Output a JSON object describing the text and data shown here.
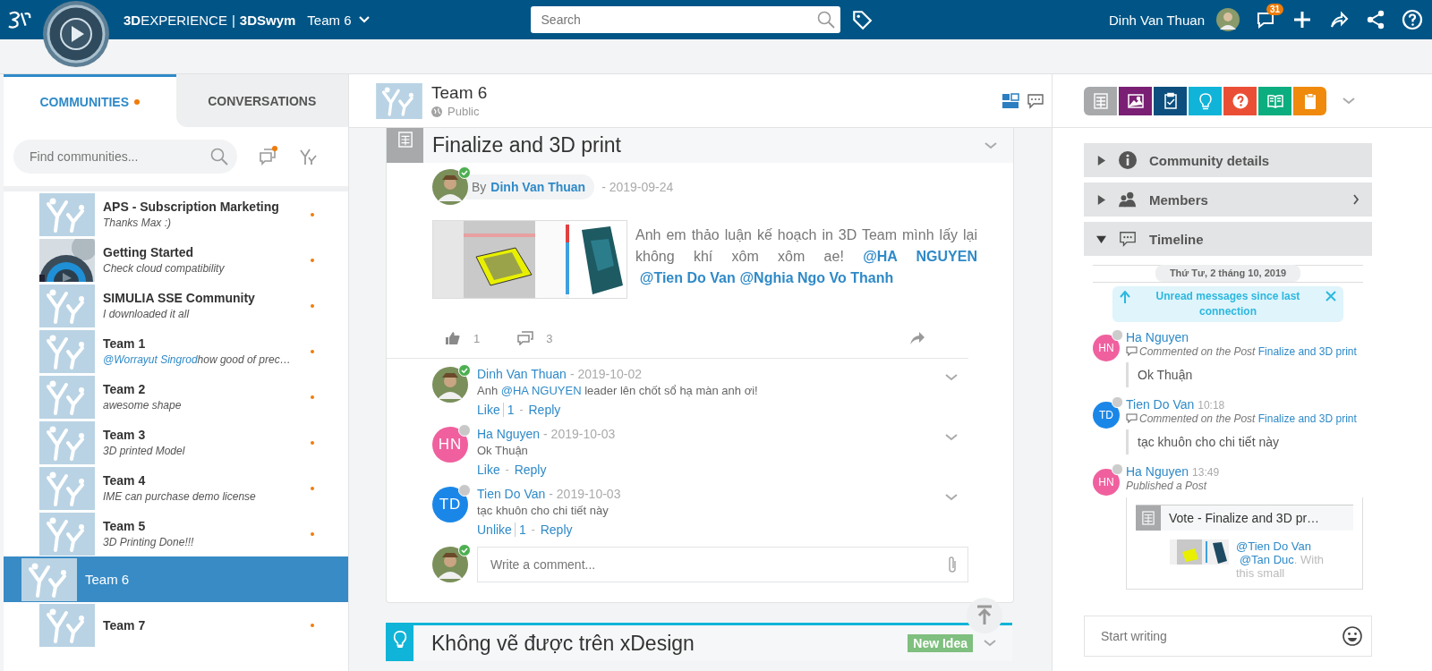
{
  "topbar": {
    "brand": "**3D**EXPERIENCE",
    "separator": "|",
    "app": "3DSwym",
    "space": "Team 6",
    "search_placeholder": "Search",
    "user": "Dinh Van Thuan",
    "notification_count": "31"
  },
  "left": {
    "tabs": [
      {
        "label": "COMMUNITIES",
        "selected": true,
        "unread": true
      },
      {
        "label": "CONVERSATIONS",
        "selected": false,
        "unread": false
      }
    ],
    "search_placeholder": "Find communities...",
    "new_conversation_unread": true,
    "communities": [
      {
        "name": "APS - Subscription Marketing",
        "text": "Thanks Max :)",
        "kind": "logo",
        "unread": true,
        "selected": false
      },
      {
        "name": "Getting Started",
        "text": "Check cloud compatibility",
        "kind": "picture",
        "unread": true,
        "selected": false
      },
      {
        "name": "SIMULIA SSE Community",
        "text": "I downloaded it all",
        "kind": "logo",
        "unread": true,
        "selected": false
      },
      {
        "name": "Team 1",
        "mention": "@Worrayut Singrod",
        "text": "how good of prec…",
        "kind": "logo",
        "unread": true,
        "selected": false
      },
      {
        "name": "Team 2",
        "text": "awesome shape",
        "kind": "logo",
        "unread": true,
        "selected": false
      },
      {
        "name": "Team 3",
        "text": "3D printed Model",
        "kind": "logo",
        "unread": true,
        "selected": false
      },
      {
        "name": "Team 4",
        "text": "IME can purchase demo license",
        "kind": "logo",
        "unread": true,
        "selected": false
      },
      {
        "name": "Team 5",
        "text": "3D Printing Done!!!",
        "kind": "logo",
        "unread": true,
        "selected": false
      },
      {
        "name": "Team 6",
        "kind": "logo",
        "unread": false,
        "selected": true
      },
      {
        "name": "Team 7",
        "kind": "logo",
        "unread": true,
        "selected": false
      }
    ]
  },
  "header": {
    "title": "Team 6",
    "visibility": "Public"
  },
  "post": {
    "title": "Finalize and 3D print",
    "by": "By",
    "author": "Dinh Van Thuan",
    "date": "- 2019-09-24",
    "body": [
      {
        "text": "Anh em thảo luận kế hoạch in 3D Team mình lấy lại không khí xôm xôm ae! ",
        "mention": false
      },
      {
        "text": "@HA NGUYEN",
        "mention": true
      },
      {
        "text": "@Tien Do Van",
        "mention": true
      },
      {
        "text": "@Nghia Ngo Vo Thanh",
        "mention": true
      }
    ],
    "likes": "1",
    "comment_count": "3",
    "action_separator": "-",
    "comments": [
      {
        "author": "Dinh Van Thuan",
        "date": "- 2019-10-02",
        "online": true,
        "body": [
          {
            "text": "Anh ",
            "mention": false
          },
          {
            "text": "@HA NGUYEN",
            "mention": true
          },
          {
            "text": " leader lên chốt sổ hạ màn anh ơi!",
            "mention": false
          }
        ],
        "like_label": "Like",
        "like_count": "1",
        "reply_label": "Reply"
      },
      {
        "author": "Ha Nguyen",
        "date": "- 2019-10-03",
        "kind": "initials",
        "initials": "HN",
        "color": "#f0609e",
        "online": false,
        "body": [
          {
            "text": "Ok Thuận",
            "mention": false
          }
        ],
        "like_label": "Like",
        "reply_label": "Reply"
      },
      {
        "author": "Tien Do Van",
        "date": "- 2019-10-03",
        "kind": "initials",
        "initials": "TD",
        "color": "#1a87e8",
        "online": false,
        "body": [
          {
            "text": "tạc khuôn cho chi tiết này",
            "mention": false
          }
        ],
        "like_label": "Unlike",
        "like_count": "1",
        "reply_label": "Reply"
      }
    ],
    "comment_placeholder": "Write a comment..."
  },
  "next_post": {
    "title": "Không vẽ được trên xDesign",
    "badge": "New Idea"
  },
  "right": {
    "post_types": [
      {
        "kind": "article",
        "color": "#a7a9ab"
      },
      {
        "kind": "media",
        "color": "#7a1f74"
      },
      {
        "kind": "survey",
        "color": "#0c4f7e"
      },
      {
        "kind": "idea",
        "color": "#10b4d8"
      },
      {
        "kind": "question",
        "color": "#ea4f35"
      },
      {
        "kind": "wiki",
        "color": "#0cad7e"
      },
      {
        "kind": "clipboard",
        "color": "#ef8a0c"
      }
    ],
    "panels": [
      {
        "label": "Community details",
        "kind": "info",
        "expanded": false
      },
      {
        "label": "Members",
        "kind": "members",
        "expanded": false
      },
      {
        "label": "Timeline",
        "kind": "timeline",
        "expanded": true
      }
    ],
    "date_separator": "Thứ Tư, 2 tháng 10, 2019",
    "unread_banner": "Unread messages since last connection",
    "timeline": [
      {
        "initials": "HN",
        "color": "#f0609e",
        "name": "Ha Nguyen",
        "kind": "comment",
        "activity": "Commented on the Post",
        "link": "Finalize and 3D print",
        "quote": "Ok Thuận"
      },
      {
        "initials": "TD",
        "color": "#1a87e8",
        "name": "Tien Do Van",
        "time": "10:18",
        "kind": "comment",
        "activity": "Commented on the Post",
        "link": "Finalize and 3D print",
        "quote": "tạc khuôn cho chi tiết này"
      },
      {
        "initials": "HN",
        "color": "#f0609e",
        "name": "Ha Nguyen",
        "time": "13:49",
        "kind": "published",
        "activity": "Published a Post",
        "card_title": "Vote - Finalize and 3D pr…",
        "card_body": [
          {
            "text": "@Tien Do Van",
            "mention": true
          },
          {
            "text": "@Tan Duc",
            "mention": true
          },
          {
            "text": ". With this small",
            "mention": false
          }
        ]
      }
    ],
    "input_placeholder": "Start writing"
  }
}
